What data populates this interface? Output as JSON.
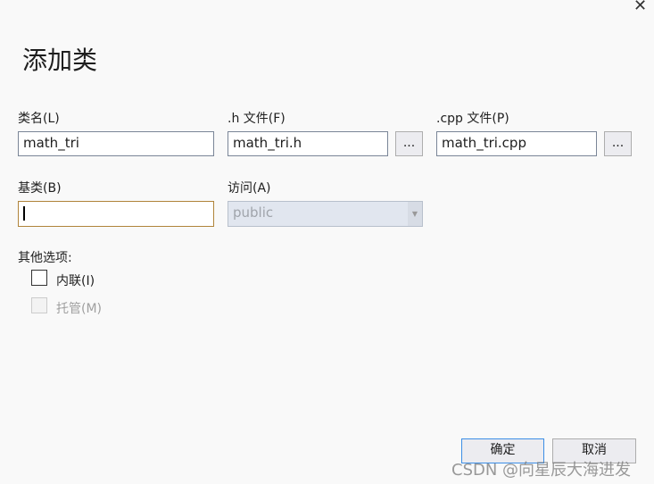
{
  "dialog": {
    "title": "添加类",
    "close_icon": "close-icon"
  },
  "fields": {
    "class_name": {
      "label": "类名(L)",
      "value": "math_tri"
    },
    "h_file": {
      "label": ".h 文件(F)",
      "value": "math_tri.h",
      "browse": "..."
    },
    "cpp_file": {
      "label": ".cpp 文件(P)",
      "value": "math_tri.cpp",
      "browse": "..."
    },
    "base_class": {
      "label": "基类(B)",
      "value": ""
    },
    "access": {
      "label": "访问(A)",
      "value": "public"
    }
  },
  "options": {
    "label": "其他选项:",
    "inline": {
      "label": "内联(I)",
      "checked": false
    },
    "managed": {
      "label": "托管(M)",
      "checked": false,
      "disabled": true
    }
  },
  "buttons": {
    "ok": "确定",
    "cancel": "取消"
  },
  "watermark": "CSDN @向星辰大海进发"
}
